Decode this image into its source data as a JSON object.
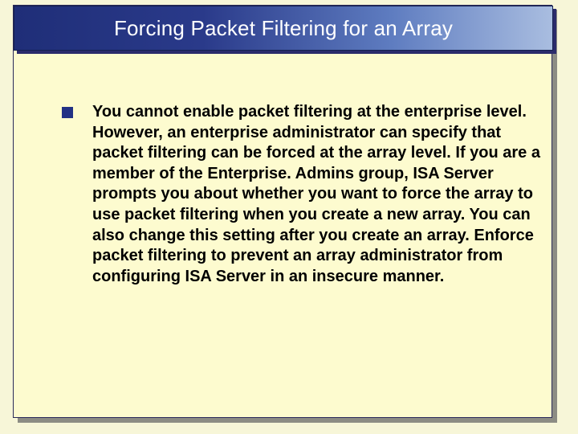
{
  "slide": {
    "title": "Forcing Packet Filtering for an Array",
    "bullets": [
      {
        "text": "You cannot enable packet filtering at the enterprise level. However, an enterprise administrator can specify that packet filtering can be forced at the array level. If you are a member of the Enterprise. Admins group, ISA Server prompts you about whether you want to force the array to use packet filtering when you create a new array. You can also change this setting after you create an array. Enforce packet filtering to prevent an array administrator from configuring ISA Server in an insecure manner."
      }
    ]
  }
}
